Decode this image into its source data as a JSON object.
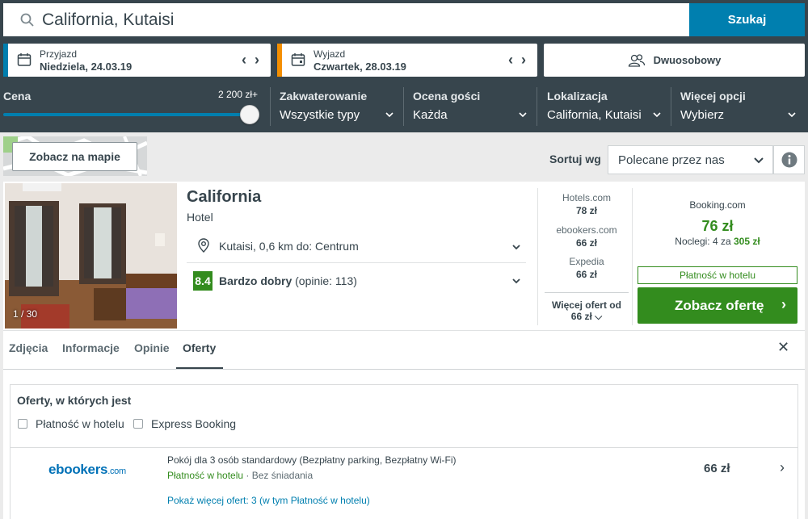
{
  "search": {
    "value": "California, Kutaisi",
    "button": "Szukaj"
  },
  "checkin": {
    "label": "Przyjazd",
    "value": "Niedziela, 24.03.19",
    "accent": "#007faf"
  },
  "checkout": {
    "label": "Wyjazd",
    "value": "Czwartek, 28.03.19",
    "accent": "#f48f00"
  },
  "room": {
    "label": "Dwuosobowy"
  },
  "filters": {
    "price": {
      "title": "Cena",
      "max": "2 200 zł+",
      "level": 1.0
    },
    "accommodation": {
      "title": "Zakwaterowanie",
      "value": "Wszystkie typy"
    },
    "rating": {
      "title": "Ocena gości",
      "value": "Każda"
    },
    "location": {
      "title": "Lokalizacja",
      "value": "California, Kutaisi"
    },
    "more": {
      "title": "Więcej opcji",
      "value": "Wybierz"
    }
  },
  "map": {
    "button": "Zobacz na mapie"
  },
  "sort": {
    "label": "Sortuj wg",
    "value": "Polecane przez nas"
  },
  "hotel": {
    "name": "California",
    "type": "Hotel",
    "photo_count": "1 / 30",
    "location": "Kutaisi, 0,6 km do: Centrum",
    "rating_score": "8.4",
    "rating_label": "Bardzo dobry",
    "rating_count": "(opinie: 113)",
    "providers": [
      {
        "name": "Hotels.com",
        "price": "78 zł"
      },
      {
        "name": "ebookers.com",
        "price": "66 zł"
      },
      {
        "name": "Expedia",
        "price": "66 zł"
      }
    ],
    "more_offers_label": "Więcej ofert od",
    "more_offers_price": "66 zł",
    "deal": {
      "provider": "Booking.com",
      "price": "76 zł",
      "nights_prefix": "Noclegi: 4 za",
      "nights_total": "305 zł",
      "payment": "Płatność w hotelu",
      "button": "Zobacz ofertę"
    }
  },
  "tabs": [
    {
      "label": "Zdjęcia"
    },
    {
      "label": "Informacje"
    },
    {
      "label": "Opinie"
    },
    {
      "label": "Oferty"
    }
  ],
  "offers": {
    "title": "Oferty, w których jest",
    "checkbox_pay": "Płatność w hotelu",
    "checkbox_express": "Express Booking",
    "items": [
      {
        "logo_main": "ebookers",
        "logo_suffix": ".com",
        "description": "Pokój dla 3 osób standardowy (Bezpłatny parking, Bezpłatny Wi-Fi)",
        "payment": "Płatność w hotelu",
        "breakfast": "Bez śniadania",
        "price": "66 zł"
      }
    ],
    "more_link": "Pokaż więcej ofert: 3 (w tym Płatność w hotelu)"
  }
}
